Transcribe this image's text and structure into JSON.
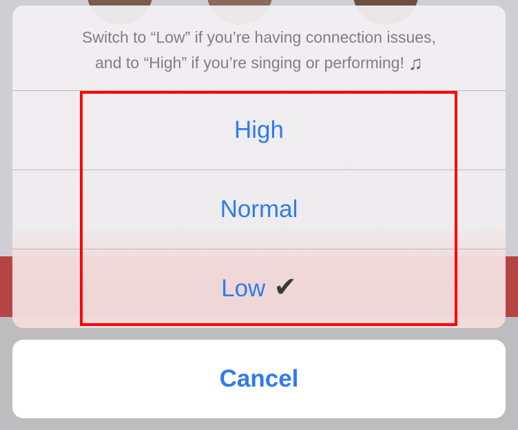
{
  "sheet": {
    "message_line1": "Switch to “Low” if you’re having connection issues,",
    "message_line2": "and to “High” if you’re singing or performing!",
    "note_symbol": "♫",
    "options": [
      {
        "label": "High",
        "selected": false
      },
      {
        "label": "Normal",
        "selected": false
      },
      {
        "label": "Low",
        "selected": true
      }
    ],
    "check_mark": "✔"
  },
  "cancel": {
    "label": "Cancel"
  },
  "colors": {
    "accent": "#2f7af0",
    "highlight_border": "#ff0000"
  }
}
